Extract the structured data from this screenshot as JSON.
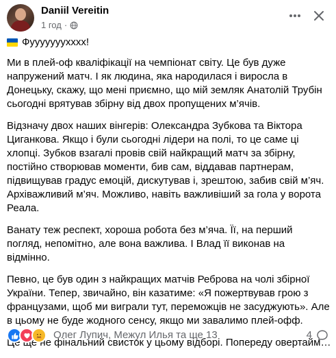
{
  "post": {
    "author": "Daniil Vereitin",
    "time": "1 год",
    "separator": "·",
    "flag_icon": "ukraine-flag-icon",
    "first_line": "Фууууууухххх!",
    "paragraphs": [
      "Ми в плей-оф кваліфікації на чемпіонат світу. Це був дуже напружений матч. І як людина, яка народилася і виросла в Донецьку, скажу, що мені приємно, що мій земляк Анатолій Трубін сьогодні врятував збірну від двох пропущених м’ячів.",
      "Відзначу двох наших вінгерів: Олександра Зубкова та Віктора Циганкова. Якщо і були сьогодні лідери на полі, то це саме ці хлопці. Зубков взагалі провів свій найкращий матч за збірну, постійно створював моменти, бив сам, віддавав партнерам, підвищував градус емоцій, дискутував і, зрештою, забив свій м’яч. Архіважливий м’яч. Можливо, навіть важливіший за гола у ворота Реала.",
      "Ванату теж респект, хороша робота без м’яча. Її, на перший погляд, непомітно, але вона важлива. І Влад її виконав на відмінно.",
      "Певно, це був один з найкращих матчів Реброва на чолі збірної України. Тепер, звичайно, він казатиме: «Я пожертвував грою з французами, щоб ми виграли тут, переможців не засуджують». Але в цьому не буде жодного сенсу, якщо ми завалимо плей-офф."
    ],
    "last_paragraph": "Це ще не фінальний свисток у цьому відборі. Попереду овертайм…",
    "see_more": "",
    "reactions": {
      "names": "Олег Лупич, Межул Илья та ще 13",
      "comments": "4"
    },
    "colors": {
      "text": "#050505",
      "secondary": "#65676b",
      "like": "#1877f2",
      "love": "#f33e58",
      "care": "#f7b928"
    }
  }
}
